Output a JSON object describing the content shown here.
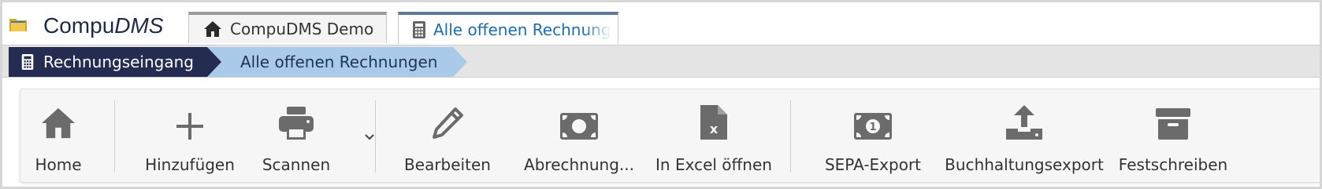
{
  "app": {
    "name_plain": "Compu",
    "name_italic": "DMS"
  },
  "tabs": [
    {
      "label": "CompuDMS Demo",
      "icon": "home-icon",
      "active": false
    },
    {
      "label": "Alle offenen Rechnung",
      "icon": "calculator-icon",
      "active": true
    }
  ],
  "breadcrumb": [
    {
      "label": "Rechnungseingang",
      "icon": "calculator-icon"
    },
    {
      "label": "Alle offenen Rechnungen"
    }
  ],
  "toolbar": {
    "home": "Home",
    "add": "Hinzufügen",
    "scan": "Scannen",
    "edit": "Bearbeiten",
    "billing": "Abrechnung...",
    "excel": "In Excel öffnen",
    "sepa": "SEPA-Export",
    "accounting": "Buchhaltungsexport",
    "finalize": "Festschreiben"
  },
  "colors": {
    "nav_dark": "#252c52",
    "nav_light": "#a9cbe9",
    "active_tab_text": "#1f6cb0",
    "icon_gray": "#6b6b6b"
  }
}
